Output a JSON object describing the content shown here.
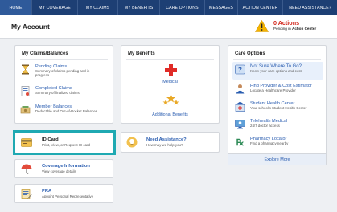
{
  "nav": {
    "items": [
      {
        "label": "HOME",
        "active": true
      },
      {
        "label": "MY COVERAGE",
        "active": false
      },
      {
        "label": "MY CLAIMS",
        "active": false
      },
      {
        "label": "MY BENEFITS",
        "active": false
      },
      {
        "label": "CARE OPTIONS",
        "active": false
      },
      {
        "label": "MESSAGES",
        "active": false
      },
      {
        "label": "ACTION CENTER",
        "active": false
      },
      {
        "label": "NEED ASSISTANCE?",
        "active": false
      }
    ]
  },
  "header": {
    "title": "My Account",
    "actions_count": "0 Actions",
    "actions_pending_prefix": "Pending in",
    "actions_pending_link": "Action Center"
  },
  "claims_card": {
    "title": "My Claims/Balances",
    "items": [
      {
        "title": "Pending Claims",
        "sub": "Summary of claims pending and in progress",
        "icon": "hourglass-icon"
      },
      {
        "title": "Completed Claims",
        "sub": "Summary of finalized claims",
        "icon": "document-icon"
      },
      {
        "title": "Member Balances",
        "sub": "Deductible and Out-of-Pocket Balances",
        "icon": "balance-icon"
      }
    ]
  },
  "benefits_card": {
    "title": "My Benefits",
    "medical_label": "Medical",
    "additional_label": "Additional Benefits"
  },
  "care_card": {
    "title": "Care Options",
    "items": [
      {
        "title": "Not Sure Where To Go?",
        "sub": "Know your care options and cost",
        "icon": "question-icon"
      },
      {
        "title": "Find Provider & Cost Estimator",
        "sub": "Locate a Healthcare Provider",
        "icon": "provider-icon"
      },
      {
        "title": "Student Health Center",
        "sub": "Your school's Student Health Center",
        "icon": "student-health-icon"
      },
      {
        "title": "Telehealth Medical",
        "sub": "24/7 doctor access",
        "icon": "telehealth-icon"
      },
      {
        "title": "Pharmacy Locator",
        "sub": "Find a pharmacy nearby",
        "icon": "pharmacy-icon"
      }
    ],
    "explore_label": "Explore More"
  },
  "id_card": {
    "title": "ID Card",
    "sub": "Print, View, or Request ID card"
  },
  "coverage": {
    "title": "Coverage Information",
    "sub": "View coverage details"
  },
  "pra": {
    "title": "PRA",
    "sub": "Appoint Personal Representative"
  },
  "assistance": {
    "title": "Need Assistance?",
    "sub": "How may we help you?"
  },
  "colors": {
    "nav_bg": "#1d3f74",
    "accent_link": "#2a5db0",
    "highlight": "#1fa9b2",
    "alert": "#d1261b"
  }
}
